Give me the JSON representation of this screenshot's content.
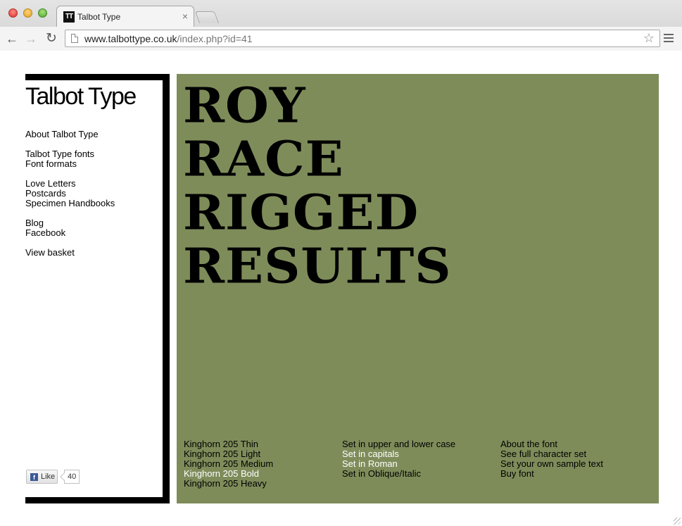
{
  "browser": {
    "tab_title": "Talbot Type",
    "favicon_text": "TT",
    "tab_close": "×",
    "url_host": "www.talbottype.co.uk",
    "url_path": "/index.php?id=41",
    "back_glyph": "←",
    "forward_glyph": "→",
    "reload_glyph": "↻",
    "star_glyph": "☆"
  },
  "sidebar": {
    "logo": "Talbot Type",
    "groups": [
      [
        "About Talbot Type"
      ],
      [
        "Talbot Type fonts",
        "Font formats"
      ],
      [
        "Love Letters",
        "Postcards",
        "Specimen Handbooks"
      ],
      [
        "Blog",
        "Facebook"
      ],
      [
        "View basket"
      ]
    ]
  },
  "facebook": {
    "icon_letter": "f",
    "like_label": "Like",
    "count": "40"
  },
  "specimen": {
    "headline": [
      "ROY",
      "RACE",
      "RIGGED",
      "RESULTS"
    ],
    "background": "#7e8c5a",
    "weights": [
      "Kinghorn 205 Thin",
      "Kinghorn 205 Light",
      "Kinghorn 205 Medium",
      "Kinghorn 205 Bold",
      "Kinghorn 205 Heavy"
    ],
    "active_weight": "Kinghorn 205 Bold",
    "settings": [
      "Set in upper and lower case",
      "Set in capitals",
      "Set in Roman",
      "Set in Oblique/Italic"
    ],
    "active_settings": [
      "Set in capitals",
      "Set in Roman"
    ],
    "links": [
      "About the font",
      "See full character set",
      "Set your own sample text",
      "Buy font"
    ]
  }
}
